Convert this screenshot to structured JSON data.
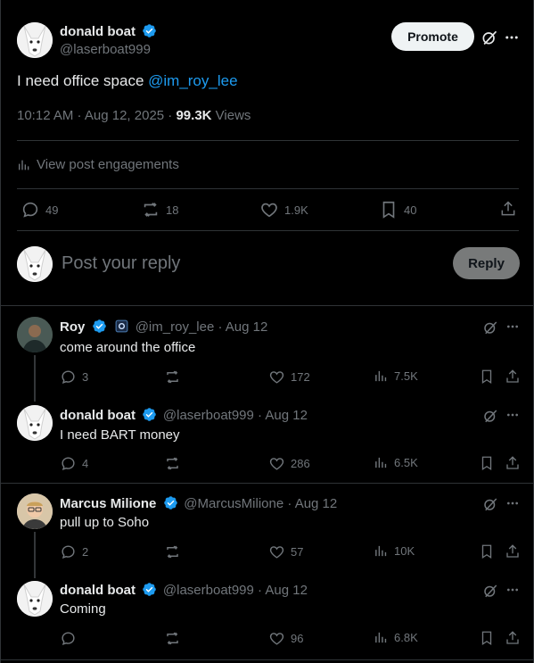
{
  "main_post": {
    "author_name": "donald boat",
    "author_handle": "@laserboat999",
    "text_prefix": "I need office space ",
    "mention": "@im_roy_lee",
    "time": "10:12 AM · Aug 12, 2025 · ",
    "views_count": "99.3K",
    "views_label": " Views",
    "promote_label": "Promote",
    "engagements_label": "View post engagements",
    "stats": {
      "replies": "49",
      "reposts": "18",
      "likes": "1.9K",
      "bookmarks": "40"
    }
  },
  "composer": {
    "placeholder": "Post your reply",
    "reply_label": "Reply"
  },
  "replies": [
    {
      "name": "Roy",
      "handle": "@im_roy_lee",
      "date": " · Aug 12",
      "text": "come around the office",
      "replies": "3",
      "reposts": "",
      "likes": "172",
      "views": "7.5K"
    },
    {
      "name": "donald boat",
      "handle": "@laserboat999",
      "date": " · Aug 12",
      "text": "I need BART money",
      "replies": "4",
      "reposts": "",
      "likes": "286",
      "views": "6.5K"
    },
    {
      "name": "Marcus Milione",
      "handle": "@MarcusMilione",
      "date": " · Aug 12",
      "text": "pull up to Soho",
      "replies": "2",
      "reposts": "",
      "likes": "57",
      "views": "10K"
    },
    {
      "name": "donald boat",
      "handle": "@laserboat999",
      "date": " · Aug 12",
      "text": "Coming",
      "replies": "",
      "reposts": "",
      "likes": "96",
      "views": "6.8K"
    }
  ],
  "colors": {
    "accent": "#1d9bf0",
    "muted": "#71767b",
    "divider": "#2f3336",
    "background": "#000000"
  }
}
